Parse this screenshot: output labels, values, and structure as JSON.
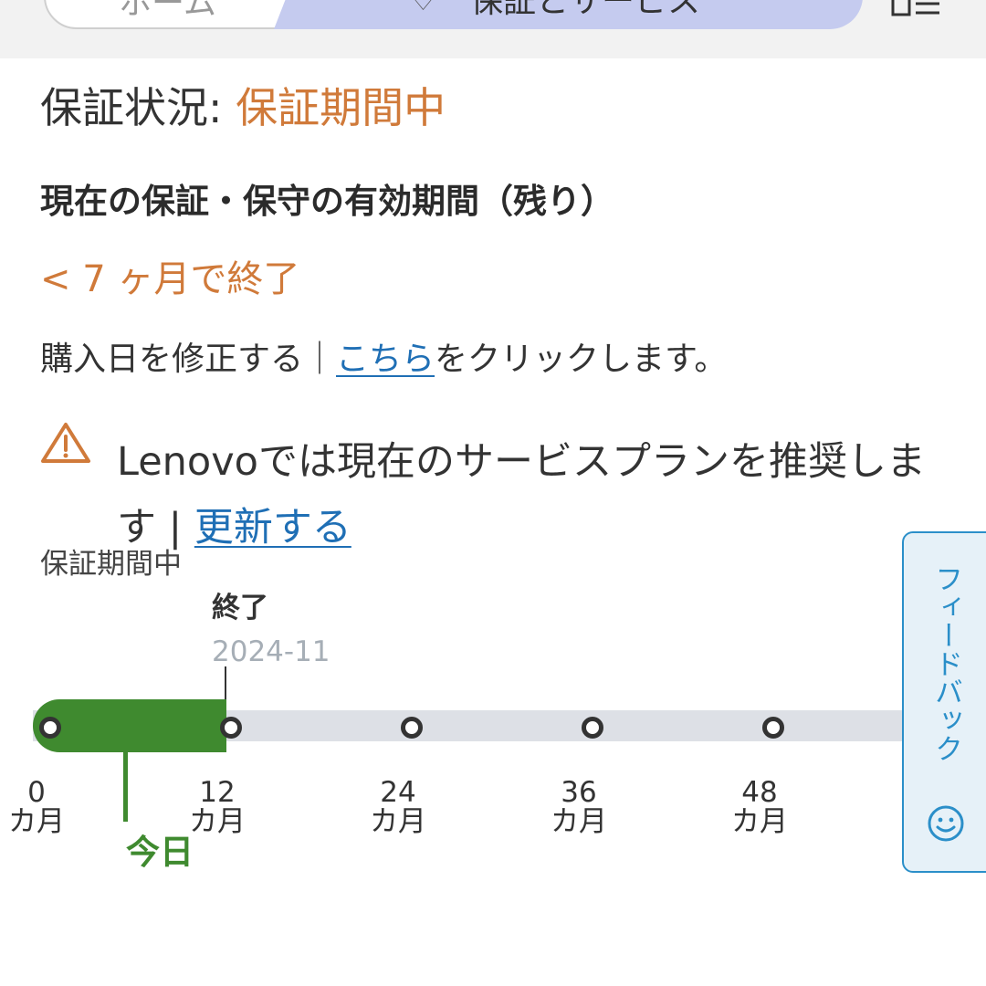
{
  "breadcrumb": {
    "home_label": "ホーム",
    "current_label": "保証とサービス",
    "current_icon": "heart-icon"
  },
  "warranty": {
    "status_label": "保証状況: ",
    "status_value": "保証期間中",
    "period_title": "現在の保証・保守の有効期間（残り）",
    "remaining": "< 7 ヶ月で終了",
    "purchase_prefix": "購入日を修正する｜",
    "purchase_link": "こちら",
    "purchase_suffix": "をクリックします。",
    "recommend_text": "Lenovoでは現在のサービスプランを推奨します | ",
    "recommend_link": "更新する"
  },
  "timeline": {
    "caption": "保証期間中",
    "end_label": "終了",
    "end_date": "2024-11",
    "today_label": "今日",
    "ticks": [
      {
        "value": "0",
        "unit": "カ月"
      },
      {
        "value": "12",
        "unit": "カ月"
      },
      {
        "value": "24",
        "unit": "カ月"
      },
      {
        "value": "36",
        "unit": "カ月"
      },
      {
        "value": "48",
        "unit": "カ月"
      }
    ],
    "coverage_months": 12,
    "today_months": 5
  },
  "feedback": {
    "label": "フィードバック",
    "icon": "smiley-icon"
  },
  "colors": {
    "accent_orange": "#d07a3a",
    "timeline_green": "#3f8a2f",
    "link_blue": "#1f6fb5",
    "feedback_blue": "#2b8fc9",
    "breadcrumb_active": "#c5cbef"
  }
}
